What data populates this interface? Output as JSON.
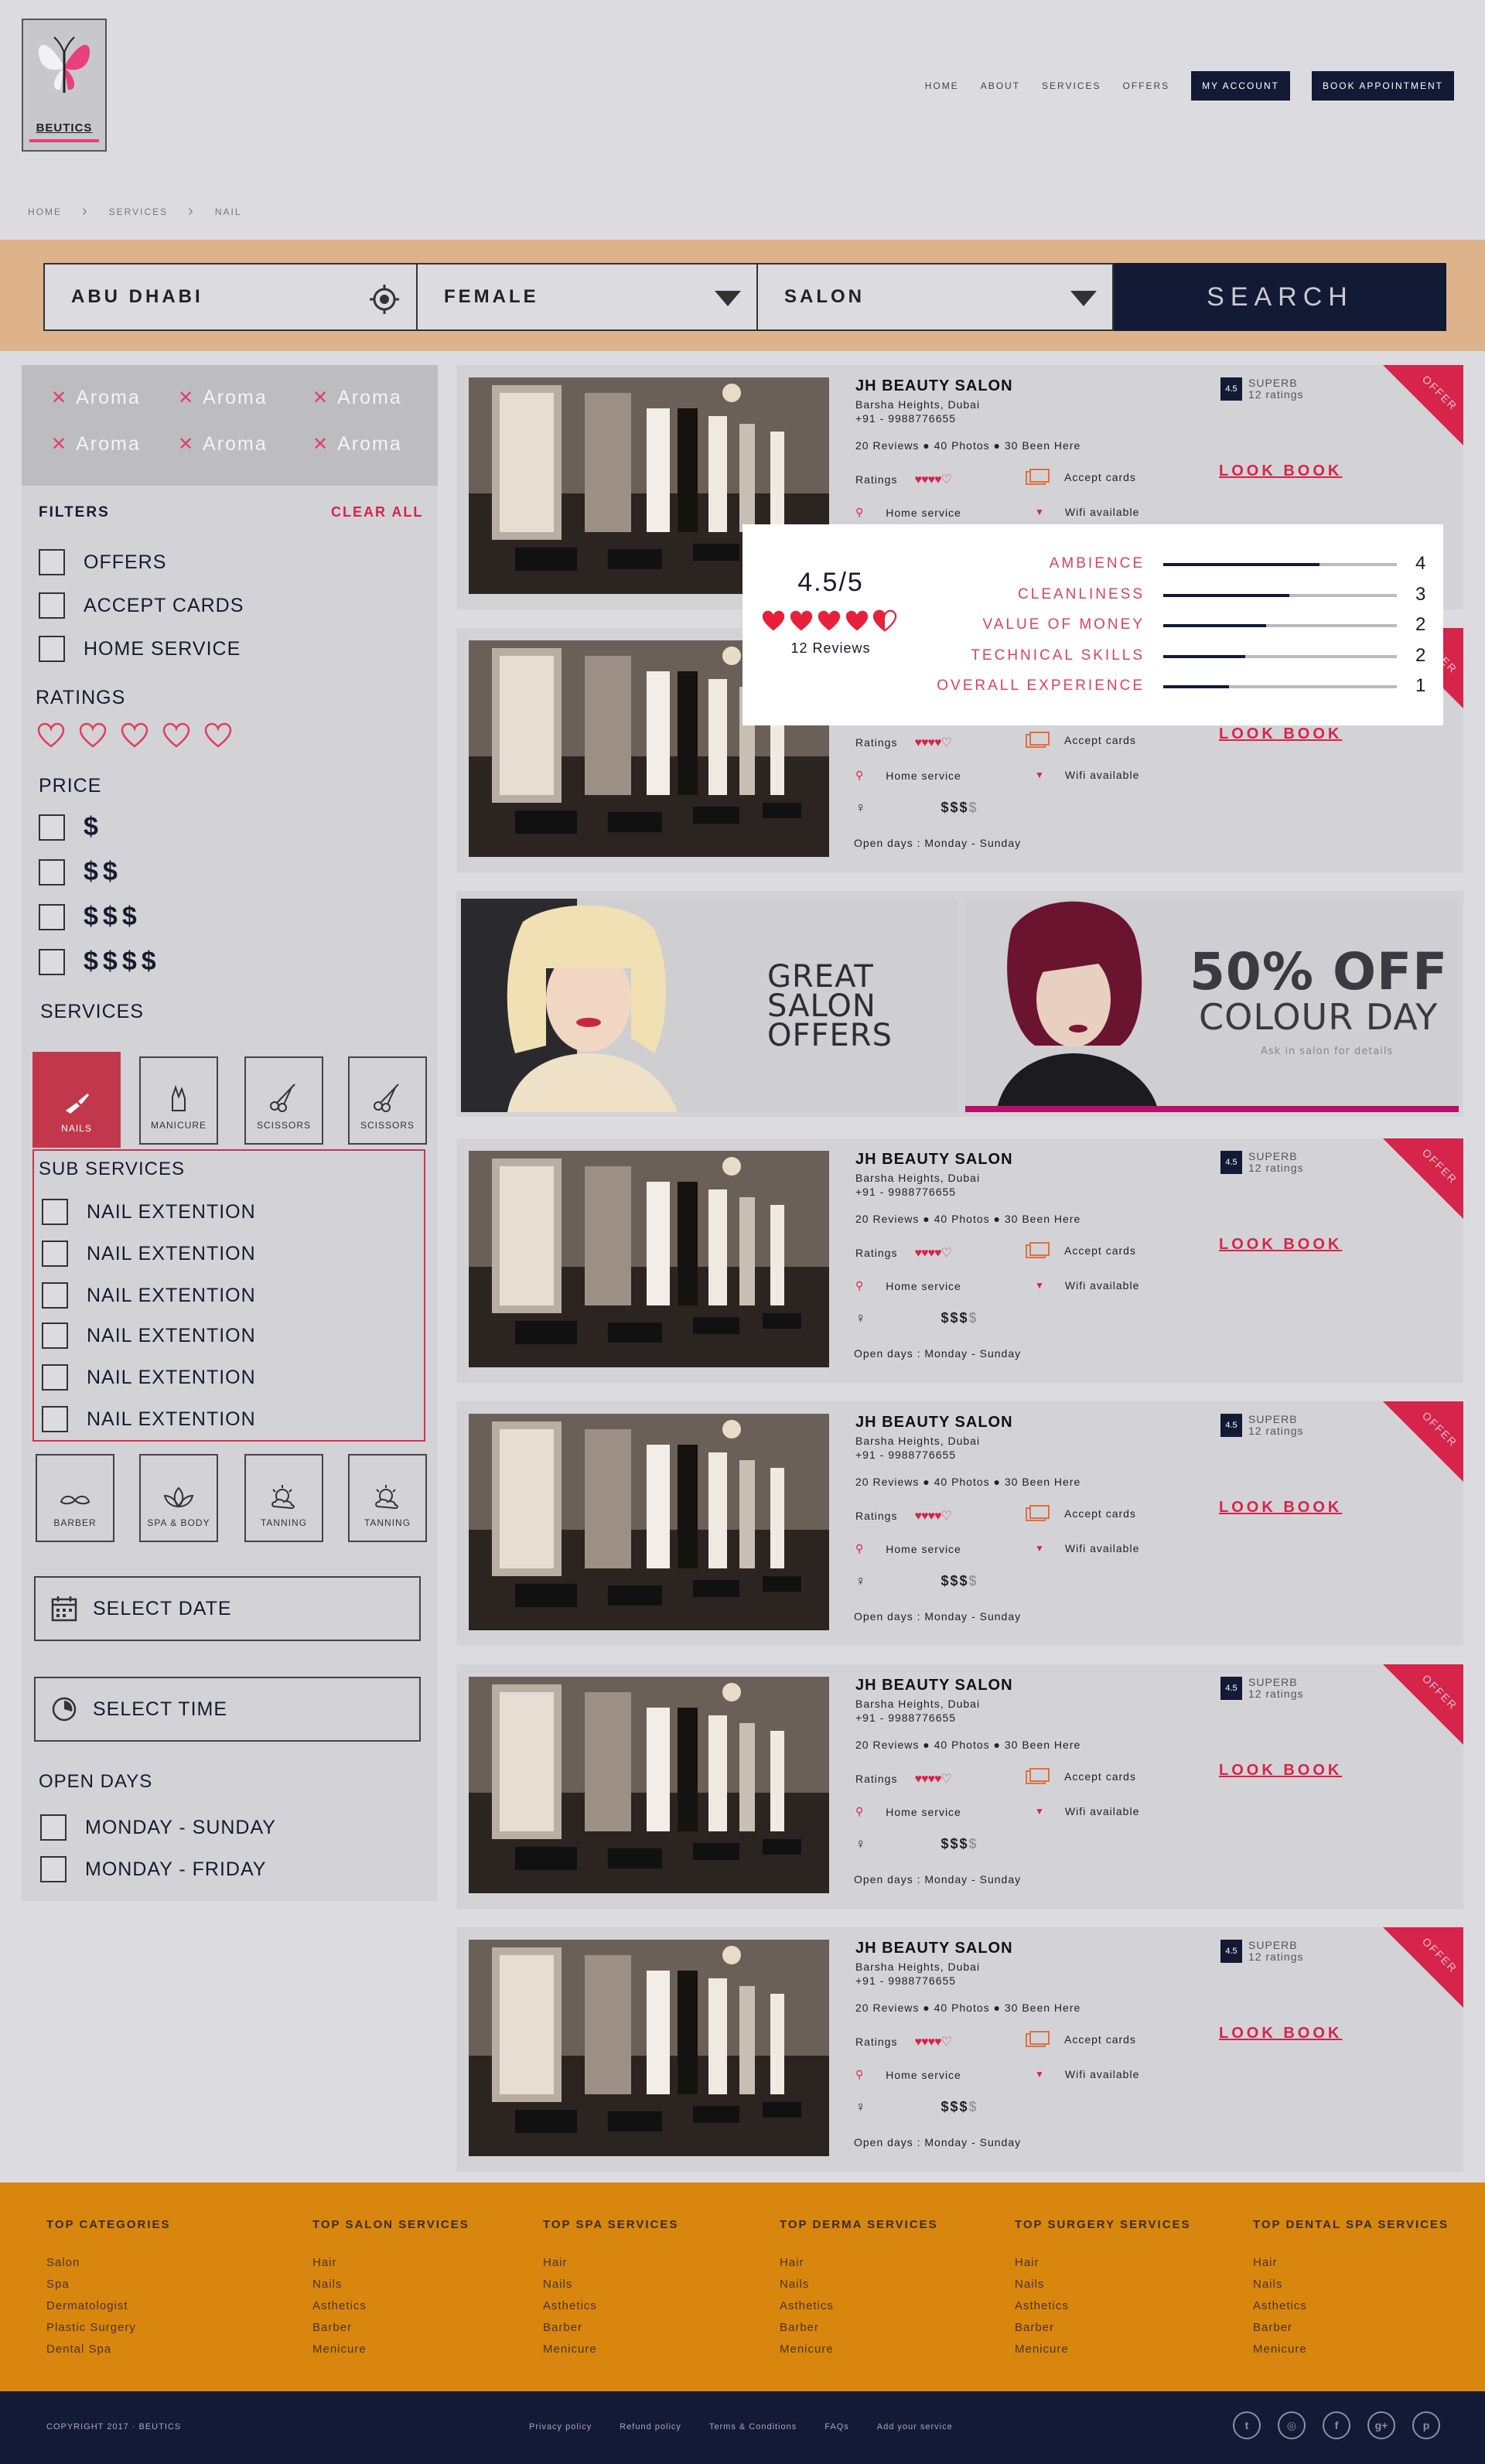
{
  "brand": {
    "name": "BEUTICS"
  },
  "nav": {
    "items": [
      "HOME",
      "ABOUT",
      "SERVICES",
      "OFFERS"
    ],
    "account": "MY ACCOUNT",
    "book": "BOOK APPOINTMENT"
  },
  "breadcrumb": [
    "HOME",
    "SERVICES",
    "NAIL"
  ],
  "search": {
    "location": "ABU DHABI",
    "gender": "FEMALE",
    "category": "SALON",
    "button": "SEARCH"
  },
  "sidebar": {
    "tags": [
      "Aroma",
      "Aroma",
      "Aroma",
      "Aroma",
      "Aroma",
      "Aroma"
    ],
    "filters_title": "FILTERS",
    "clear_all": "CLEAR ALL",
    "filters": [
      "OFFERS",
      "ACCEPT CARDS",
      "HOME SERVICE"
    ],
    "ratings_title": "RATINGS",
    "price_title": "PRICE",
    "prices": [
      "$",
      "$$",
      "$$$",
      "$$$$"
    ],
    "services_title": "SERVICES",
    "services_top": [
      "NAILS",
      "MANICURE",
      "SCISSORS",
      "SCISSORS"
    ],
    "sub_services_title": "SUB SERVICES",
    "sub_services": [
      "NAIL EXTENTION",
      "NAIL EXTENTION",
      "NAIL EXTENTION",
      "NAIL EXTENTION",
      "NAIL EXTENTION",
      "NAIL EXTENTION"
    ],
    "services_bottom": [
      "BARBER",
      "SPA & BODY",
      "TANNING",
      "TANNING"
    ],
    "select_date": "SELECT DATE",
    "select_time": "SELECT TIME",
    "open_days_title": "OPEN DAYS",
    "open_days": [
      "MONDAY - SUNDAY",
      "MONDAY - FRIDAY"
    ]
  },
  "listing": {
    "name": "JH BEAUTY SALON",
    "address": "Barsha Heights, Dubai",
    "phone": "+91 - 9988776655",
    "stats": "20 Reviews ● 40 Photos ● 30 Been Here",
    "ratings_label": "Ratings",
    "accept_cards": "Accept cards",
    "home_service": "Home service",
    "wifi": "Wifi available",
    "price_on": "$$$",
    "price_off": "$",
    "open_days": "Open days : Monday  -  Sunday",
    "look_book": "LOOK BOOK",
    "badge_score": "4.5",
    "badge_label": "SUPERB",
    "badge_count": "12 ratings",
    "offer": "OFFER"
  },
  "popup": {
    "score": "4.5/5",
    "reviews": "12 Reviews",
    "rows": [
      {
        "label": "AMBIENCE",
        "value": "4",
        "fill": 0.67
      },
      {
        "label": "CLEANLINESS",
        "value": "3",
        "fill": 0.54
      },
      {
        "label": "VALUE OF MONEY",
        "value": "2",
        "fill": 0.44
      },
      {
        "label": "TECHNICAL SKILLS",
        "value": "2",
        "fill": 0.35
      },
      {
        "label": "OVERALL EXPERIENCE",
        "value": "1",
        "fill": 0.28
      }
    ]
  },
  "banners": {
    "left": [
      "GREAT",
      "SALON",
      "OFFERS"
    ],
    "right_big": "50% OFF",
    "right_sub": "COLOUR DAY",
    "right_small": "Ask in salon for details"
  },
  "footer": {
    "columns": [
      {
        "title": "TOP CATEGORIES",
        "items": [
          "Salon",
          "Spa",
          "Dermatologist",
          "Plastic Surgery",
          "Dental Spa"
        ]
      },
      {
        "title": "TOP SALON SERVICES",
        "items": [
          "Hair",
          "Nails",
          "Asthetics",
          "Barber",
          "Menicure"
        ]
      },
      {
        "title": "TOP SPA SERVICES",
        "items": [
          "Hair",
          "Nails",
          "Asthetics",
          "Barber",
          "Menicure"
        ]
      },
      {
        "title": "TOP DERMA SERVICES",
        "items": [
          "Hair",
          "Nails",
          "Asthetics",
          "Barber",
          "Menicure"
        ]
      },
      {
        "title": "TOP SURGERY SERVICES",
        "items": [
          "Hair",
          "Nails",
          "Asthetics",
          "Barber",
          "Menicure"
        ]
      },
      {
        "title": "TOP DENTAL SPA SERVICES",
        "items": [
          "Hair",
          "Nails",
          "Asthetics",
          "Barber",
          "Menicure"
        ]
      }
    ],
    "copyright": "COPYRIGHT 2017  ·  BEUTICS",
    "links": [
      "Privacy policy",
      "Refund policy",
      "Terms & Conditions",
      "FAQs",
      "Add your service"
    ]
  },
  "colors": {
    "navy": "#131a36",
    "accent": "#d6244a",
    "footer": "#d8860e",
    "searchbar": "#deb38c"
  }
}
